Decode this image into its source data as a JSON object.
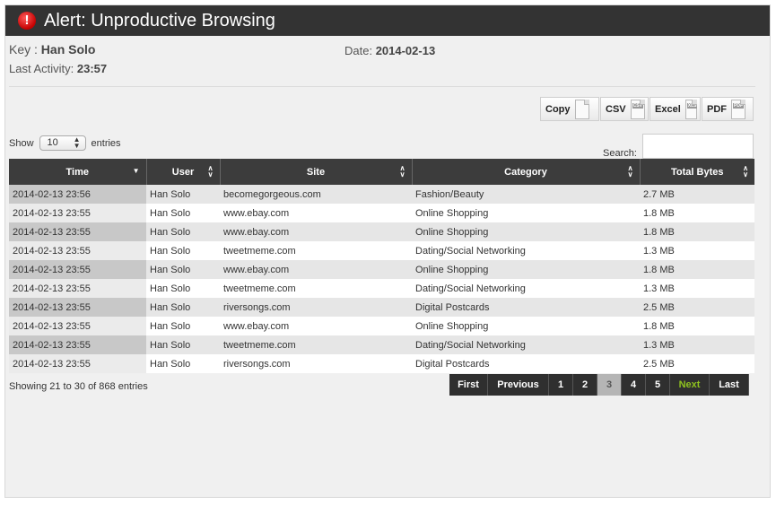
{
  "title": "Alert: Unproductive Browsing",
  "meta": {
    "key_label": "Key : ",
    "key_value": "Han Solo",
    "date_label": "Date: ",
    "date_value": "2014-02-13",
    "activity_label": "Last Activity: ",
    "activity_value": "23:57"
  },
  "exports": [
    {
      "label": "Copy",
      "icon": "copy-icon",
      "tag": ""
    },
    {
      "label": "CSV",
      "icon": "csv-file-icon",
      "tag": "CSV"
    },
    {
      "label": "Excel",
      "icon": "excel-file-icon",
      "tag": "XLS"
    },
    {
      "label": "PDF",
      "icon": "pdf-file-icon",
      "tag": "PDF"
    }
  ],
  "length": {
    "show_label": "Show",
    "selected": "10",
    "entries_label": "entries"
  },
  "search": {
    "label": "Search:",
    "value": ""
  },
  "table": {
    "columns": [
      "Time",
      "User",
      "Site",
      "Category",
      "Total Bytes"
    ],
    "rows": [
      [
        "2014-02-13 23:56",
        "Han Solo",
        "becomegorgeous.com",
        "Fashion/Beauty",
        "2.7 MB"
      ],
      [
        "2014-02-13 23:55",
        "Han Solo",
        "www.ebay.com",
        "Online Shopping",
        "1.8 MB"
      ],
      [
        "2014-02-13 23:55",
        "Han Solo",
        "www.ebay.com",
        "Online Shopping",
        "1.8 MB"
      ],
      [
        "2014-02-13 23:55",
        "Han Solo",
        "tweetmeme.com",
        "Dating/Social Networking",
        "1.3 MB"
      ],
      [
        "2014-02-13 23:55",
        "Han Solo",
        "www.ebay.com",
        "Online Shopping",
        "1.8 MB"
      ],
      [
        "2014-02-13 23:55",
        "Han Solo",
        "tweetmeme.com",
        "Dating/Social Networking",
        "1.3 MB"
      ],
      [
        "2014-02-13 23:55",
        "Han Solo",
        "riversongs.com",
        "Digital Postcards",
        "2.5 MB"
      ],
      [
        "2014-02-13 23:55",
        "Han Solo",
        "www.ebay.com",
        "Online Shopping",
        "1.8 MB"
      ],
      [
        "2014-02-13 23:55",
        "Han Solo",
        "tweetmeme.com",
        "Dating/Social Networking",
        "1.3 MB"
      ],
      [
        "2014-02-13 23:55",
        "Han Solo",
        "riversongs.com",
        "Digital Postcards",
        "2.5 MB"
      ]
    ]
  },
  "info": "Showing 21 to 30 of 868 entries",
  "pager": {
    "first": "First",
    "previous": "Previous",
    "pages": [
      "1",
      "2",
      "3",
      "4",
      "5"
    ],
    "current": "3",
    "next": "Next",
    "last": "Last"
  },
  "colors": {
    "titlebar": "#333333",
    "header": "#3c3c3c",
    "next_accent": "#8fc31f",
    "alert": "#c40000"
  }
}
